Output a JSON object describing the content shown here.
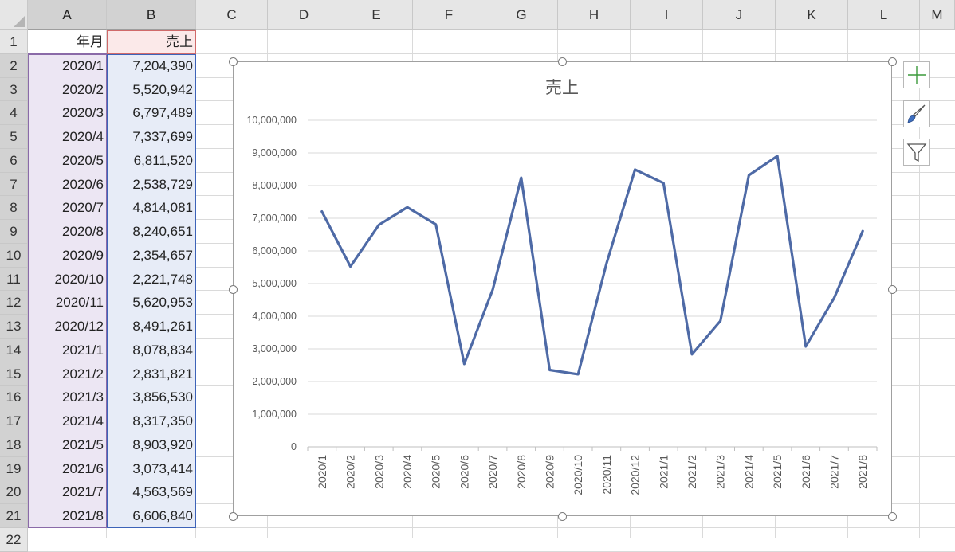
{
  "columns": [
    "A",
    "B",
    "C",
    "D",
    "E",
    "F",
    "G",
    "H",
    "I",
    "J",
    "K",
    "L",
    "M"
  ],
  "rows": [
    "1",
    "2",
    "3",
    "4",
    "5",
    "6",
    "7",
    "8",
    "9",
    "10",
    "11",
    "12",
    "13",
    "14",
    "15",
    "16",
    "17",
    "18",
    "19",
    "20",
    "21",
    "22"
  ],
  "sheet": {
    "header_a": "年月",
    "header_b": "売上",
    "data": [
      {
        "month": "2020/1",
        "sales": "7,204,390"
      },
      {
        "month": "2020/2",
        "sales": "5,520,942"
      },
      {
        "month": "2020/3",
        "sales": "6,797,489"
      },
      {
        "month": "2020/4",
        "sales": "7,337,699"
      },
      {
        "month": "2020/5",
        "sales": "6,811,520"
      },
      {
        "month": "2020/6",
        "sales": "2,538,729"
      },
      {
        "month": "2020/7",
        "sales": "4,814,081"
      },
      {
        "month": "2020/8",
        "sales": "8,240,651"
      },
      {
        "month": "2020/9",
        "sales": "2,354,657"
      },
      {
        "month": "2020/10",
        "sales": "2,221,748"
      },
      {
        "month": "2020/11",
        "sales": "5,620,953"
      },
      {
        "month": "2020/12",
        "sales": "8,491,261"
      },
      {
        "month": "2021/1",
        "sales": "8,078,834"
      },
      {
        "month": "2021/2",
        "sales": "2,831,821"
      },
      {
        "month": "2021/3",
        "sales": "3,856,530"
      },
      {
        "month": "2021/4",
        "sales": "8,317,350"
      },
      {
        "month": "2021/5",
        "sales": "8,903,920"
      },
      {
        "month": "2021/6",
        "sales": "3,073,414"
      },
      {
        "month": "2021/7",
        "sales": "4,563,569"
      },
      {
        "month": "2021/8",
        "sales": "6,606,840"
      }
    ]
  },
  "chart_data": {
    "type": "line",
    "title": "売上",
    "categories": [
      "2020/1",
      "2020/2",
      "2020/3",
      "2020/4",
      "2020/5",
      "2020/6",
      "2020/7",
      "2020/8",
      "2020/9",
      "2020/10",
      "2020/11",
      "2020/12",
      "2021/1",
      "2021/2",
      "2021/3",
      "2021/4",
      "2021/5",
      "2021/6",
      "2021/7",
      "2021/8"
    ],
    "series": [
      {
        "values": [
          7204390,
          5520942,
          6797489,
          7337699,
          6811520,
          2538729,
          4814081,
          8240651,
          2354657,
          2221748,
          5620953,
          8491261,
          8078834,
          2831821,
          3856530,
          8317350,
          8903920,
          3073414,
          4563569,
          6606840
        ]
      }
    ],
    "y_ticks": [
      "0",
      "1,000,000",
      "2,000,000",
      "3,000,000",
      "4,000,000",
      "5,000,000",
      "6,000,000",
      "7,000,000",
      "8,000,000",
      "9,000,000",
      "10,000,000"
    ],
    "ylim": [
      0,
      10000000
    ],
    "grid": true,
    "legend": "none",
    "line_color": "#4e6aa6"
  },
  "chart_tools": [
    {
      "name": "chart-elements-button",
      "icon": "plus-icon"
    },
    {
      "name": "chart-styles-button",
      "icon": "paintbrush-icon"
    },
    {
      "name": "chart-filters-button",
      "icon": "funnel-icon"
    }
  ],
  "colors": {
    "header_bg": "#e6e6e6",
    "grid_line": "#dadada",
    "sel_a_fill": "#ece6f3",
    "sel_b_fill": "#e7ecf7",
    "sel_b_header": "#fbe9e9"
  }
}
